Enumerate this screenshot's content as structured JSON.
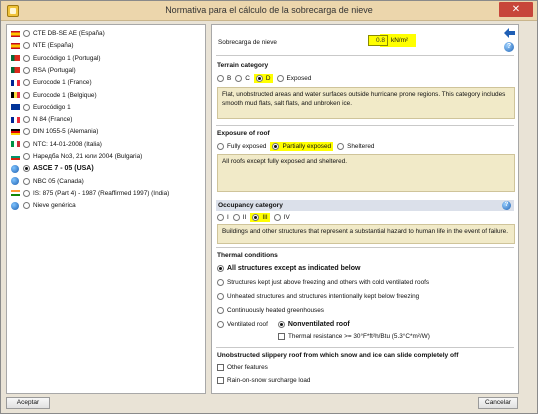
{
  "window": {
    "title": "Normativa para el cálculo de la sobrecarga de nieve",
    "close_glyph": "✕"
  },
  "norms": [
    {
      "label": "CTE DB-SE AE (España)",
      "icon": "flag-spain",
      "colors": [
        "#c60b1e",
        "#ffc400",
        "#c60b1e"
      ]
    },
    {
      "label": "NTE (España)",
      "icon": "flag-spain",
      "colors": [
        "#c60b1e",
        "#ffc400",
        "#c60b1e"
      ]
    },
    {
      "label": "Eurocódigo 1 (Portugal)",
      "icon": "flag-portugal",
      "colors": [
        "#046a38",
        "#da291c"
      ]
    },
    {
      "label": "RSA (Portugal)",
      "icon": "flag-portugal",
      "colors": [
        "#046a38",
        "#da291c"
      ]
    },
    {
      "label": "Eurocode 1 (France)",
      "icon": "flag-france",
      "colors": [
        "#002395",
        "#ffffff",
        "#ed2939"
      ]
    },
    {
      "label": "Eurocode 1 (Belgique)",
      "icon": "flag-belgium",
      "colors": [
        "#000000",
        "#fae042",
        "#ed2939"
      ]
    },
    {
      "label": "Eurocódigo 1",
      "icon": "flag-eu",
      "colors": [
        "#003399"
      ]
    },
    {
      "label": "N 84 (France)",
      "icon": "flag-france",
      "colors": [
        "#002395",
        "#ffffff",
        "#ed2939"
      ]
    },
    {
      "label": "DIN 1055-5 (Alemania)",
      "icon": "flag-germany",
      "colors": [
        "#000000",
        "#dd0000",
        "#ffce00"
      ]
    },
    {
      "label": "NTC: 14-01-2008 (Italia)",
      "icon": "flag-italy",
      "colors": [
        "#009246",
        "#ffffff",
        "#ce2b37"
      ]
    },
    {
      "label": "Наредба No3, 21 юли 2004 (Bulgaria)",
      "icon": "flag-bulgaria",
      "colors": [
        "#ffffff",
        "#00966e",
        "#d62612"
      ]
    },
    {
      "label": "ASCE 7 - 05 (USA)",
      "icon": "globe-icon",
      "selected": true
    },
    {
      "label": "NBC 05 (Canada)",
      "icon": "globe-icon"
    },
    {
      "label": "IS: 875 (Part 4) - 1987 (Reaffirmed 1997) (India)",
      "icon": "flag-india",
      "colors": [
        "#ff9933",
        "#ffffff",
        "#138808"
      ]
    },
    {
      "label": "Nieve genérica",
      "icon": "globe-icon"
    }
  ],
  "load": {
    "label": "Sobrecarga de nieve",
    "value": "0.8",
    "unit": "kN/m²"
  },
  "terrain": {
    "title": "Terrain category",
    "options": [
      "B",
      "C",
      "D",
      "Exposed"
    ],
    "selected": "D",
    "description": "Flat, unobstructed areas and water surfaces outside hurricane prone regions. This category includes smooth mud flats, salt flats, and unbroken ice."
  },
  "exposure": {
    "title": "Exposure of roof",
    "options": [
      "Fully exposed",
      "Partially exposed",
      "Sheltered"
    ],
    "selected": "Partially exposed",
    "description": "All roofs except fully exposed and sheltered."
  },
  "occupancy": {
    "title": "Occupancy category",
    "options": [
      "I",
      "II",
      "III",
      "IV"
    ],
    "selected": "III",
    "description": "Buildings and other structures that represent a substantial hazard to human life in the event of failure."
  },
  "thermal": {
    "title": "Thermal conditions",
    "options": [
      "All structures except as indicated below",
      "Structures kept just above freezing and others with cold ventilated roofs",
      "Unheated structures and structures intentionally kept below freezing",
      "Continuously heated greenhouses",
      "Ventilated roof",
      "Nonventilated roof"
    ],
    "selected": "All structures except as indicated below",
    "roof_selected": "Nonventilated roof",
    "resistance_label": "Thermal resistance >= 30°F*ft²h/Btu (5.3°C*m²/W)"
  },
  "slippery": {
    "title": "Unobstructed slippery roof from which snow and ice can slide completely off",
    "checks": [
      "Other features",
      "Rain-on-snow surcharge load"
    ]
  },
  "footer": {
    "accept": "Aceptar",
    "cancel": "Cancelar"
  }
}
